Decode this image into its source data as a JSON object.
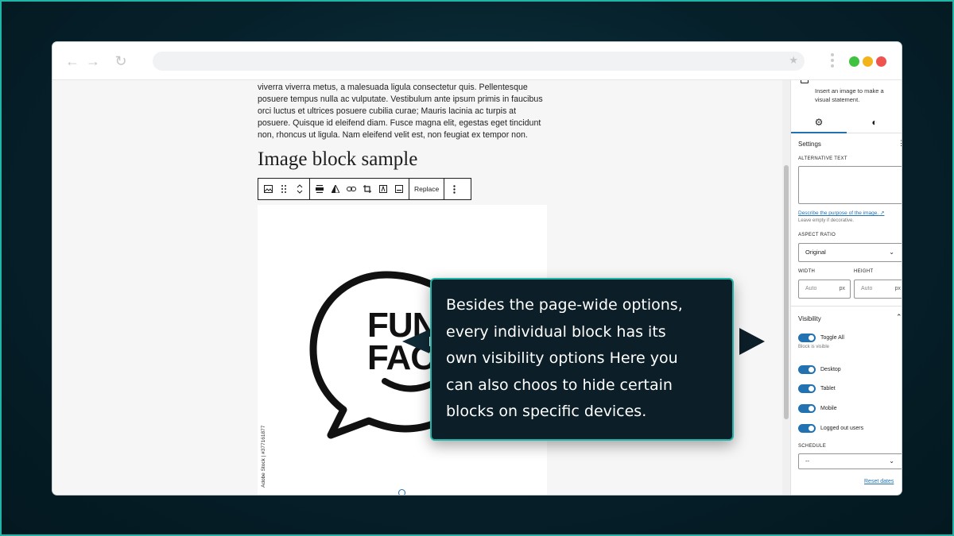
{
  "paragraph": {
    "lines": [
      "viverra viverra metus, a malesuada ligula consectetur quis. Pellentesque",
      "posuere tempus nulla ac vulputate. Vestibulum ante ipsum primis in faucibus",
      "orci luctus et ultrices posuere cubilia curae; Mauris lacinia ac turpis at",
      "posuere. Quisque id eleifend diam. Fusce magna elit, egestas eget tincidunt",
      "non, rhoncus ut ligula. Nam eleifend velit est, non feugiat ex tempor non."
    ]
  },
  "heading": "Image block sample",
  "toolbar": {
    "replace_label": "Replace"
  },
  "image": {
    "text_line1": "FUN",
    "text_line2": "FACT",
    "stock_label": "Adobe Stock | #377161877"
  },
  "sidebar": {
    "block_description": "Insert an image to make a visual statement.",
    "settings_title": "Settings",
    "alt_text_label": "ALTERNATIVE TEXT",
    "alt_text_link": "Describe the purpose of the image.",
    "alt_text_help": "Leave empty if decorative.",
    "aspect_ratio_label": "ASPECT RATIO",
    "aspect_ratio_value": "Original",
    "width_label": "WIDTH",
    "height_label": "HEIGHT",
    "width_placeholder": "Auto",
    "height_placeholder": "Auto",
    "unit": "px",
    "visibility_title": "Visibility",
    "toggles": [
      {
        "label": "Toggle All",
        "on": true
      },
      {
        "label": "Desktop",
        "on": true
      },
      {
        "label": "Tablet",
        "on": true
      },
      {
        "label": "Mobile",
        "on": true
      },
      {
        "label": "Logged out users",
        "on": true
      }
    ],
    "block_visible_note": "Block is visible",
    "schedule_label": "SCHEDULE",
    "schedule_value": "--",
    "reset_dates": "Reset dates"
  },
  "callout": {
    "lines": [
      "Besides the page-wide options,",
      "every individual block has its",
      "own visibility options  Here you",
      "can also choos to hide certain",
      "blocks on specific devices."
    ]
  },
  "colors": {
    "accent": "#1fb5a8",
    "wp_blue": "#2271b1",
    "traffic_green": "#3fc23f",
    "traffic_yellow": "#f2b31b",
    "traffic_red": "#ef5350"
  }
}
